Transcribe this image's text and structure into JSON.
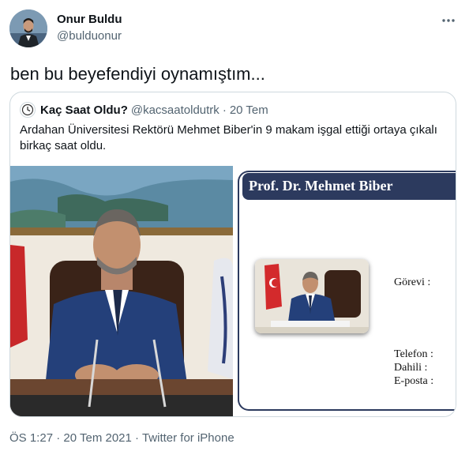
{
  "tweet": {
    "author": {
      "display_name": "Onur Buldu",
      "handle": "@bulduonur",
      "avatar_icon": "profile-photo"
    },
    "more_icon": "more-options-icon",
    "text": "ben bu beyefendiyi oynamıştım...",
    "footer": {
      "time": "ÖS 1:27",
      "date": "20 Tem 2021",
      "source": "Twitter for iPhone",
      "separator": "·"
    }
  },
  "quoted": {
    "avatar_icon": "clock-icon",
    "display_name": "Kaç Saat Oldu?",
    "handle": "@kacsaatoldutrk",
    "separator": "·",
    "date": "20 Tem",
    "text": "Ardahan Üniversitesi Rektörü Mehmet Biber'in 9 makam işgal ettiği ortaya çıkalı birkaç saat oldu.",
    "card": {
      "title": "Prof. Dr. Mehmet Biber",
      "gorevi": "Görevi :",
      "telefon": "Telefon :",
      "dahili": "Dahili :",
      "eposta": "E-posta :",
      "accent_color": "#2c3a5e"
    }
  },
  "colors": {
    "text_primary": "#0f1419",
    "text_secondary": "#536471",
    "border": "#cfd9de"
  }
}
